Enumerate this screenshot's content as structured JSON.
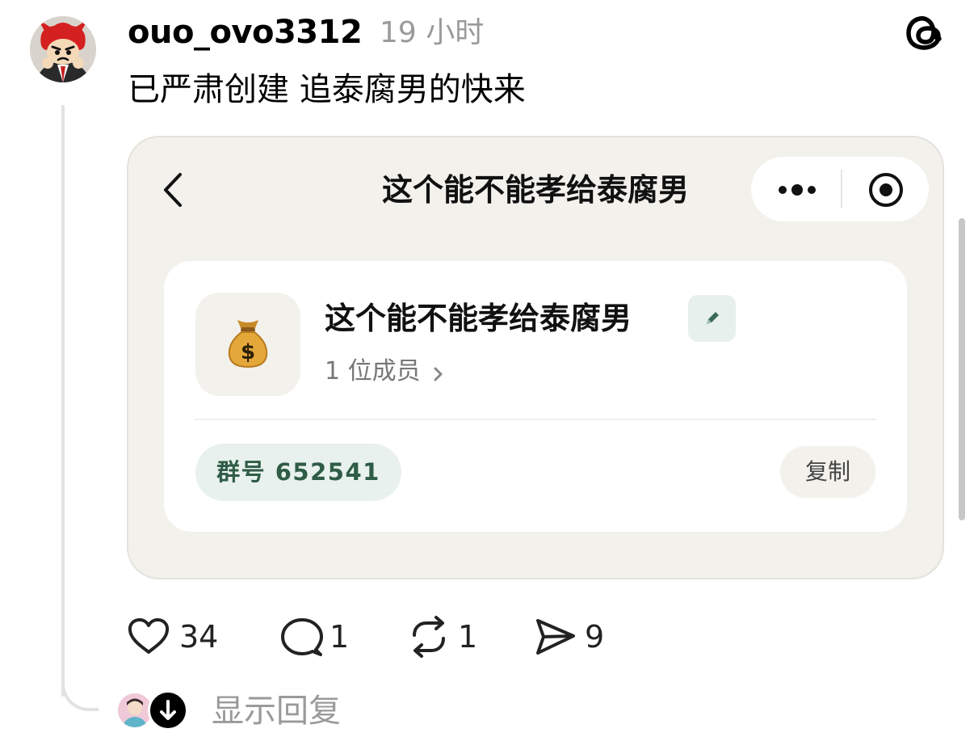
{
  "post": {
    "username": "ouo_ovo3312",
    "time": "19 小时",
    "text": "已严肃创建 追泰腐男的快来",
    "avatar_icon": "devil-avatar-icon"
  },
  "embedded_screenshot": {
    "title": "这个能不能孝给泰腐男",
    "group_name": "这个能不能孝给泰腐男",
    "group_icon": "💰",
    "members": "1 位成员",
    "group_id": "群号 652541",
    "copy_label": "复制"
  },
  "actions": {
    "likes": "34",
    "comments": "1",
    "reposts": "1",
    "shares": "9"
  },
  "replies": {
    "label": "显示回复"
  },
  "colors": {
    "card_bg": "#f3f1ec",
    "group_id_bg": "#e8f1ed",
    "group_id_text": "#2f5c46",
    "muted_text": "#9a9a9a"
  }
}
